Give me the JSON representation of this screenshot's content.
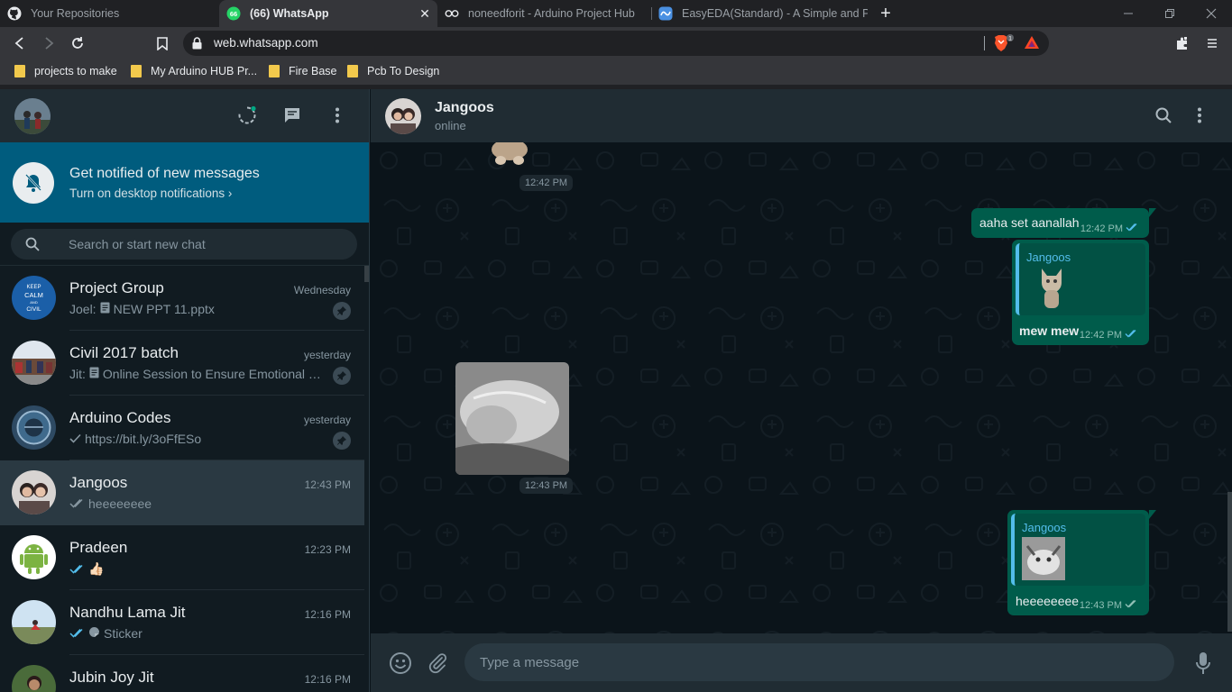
{
  "browser": {
    "tabs": [
      {
        "title": "Your Repositories",
        "icon": "github-icon",
        "active": false
      },
      {
        "title": "(66) WhatsApp",
        "icon": "whatsapp-icon",
        "active": true,
        "badge": "66"
      },
      {
        "title": "noneedforit - Arduino Project Hub",
        "icon": "arduino-icon",
        "active": false
      },
      {
        "title": "EasyEDA(Standard) - A Simple and Pow",
        "icon": "easyeda-icon",
        "active": false
      }
    ],
    "url": "web.whatsapp.com",
    "brave_badge": "1",
    "bookmarks": [
      "projects to make",
      "My Arduino HUB Pr...",
      "Fire Base",
      "Pcb To Design"
    ]
  },
  "sidebar": {
    "notification": {
      "title": "Get notified of new messages",
      "subtitle": "Turn on desktop notifications ›"
    },
    "search_placeholder": "Search or start new chat",
    "chats": [
      {
        "name": "Project Group",
        "time": "Wednesday",
        "prefix": "Joel:",
        "message": "NEW PPT 11.pptx",
        "icon": "document-icon",
        "pinned": false,
        "avatar_color": "#1b5fa8"
      },
      {
        "name": "Civil 2017 batch",
        "time": "yesterday",
        "prefix": "Jit:",
        "message": "Online Session to Ensure Emotional W...",
        "icon": "document-icon",
        "pinned": false,
        "avatar_color": "#6b4a3a"
      },
      {
        "name": "Arduino Codes",
        "time": "yesterday",
        "prefix": "",
        "message": "https://bit.ly/3oFfESo",
        "icon": "single-tick-icon",
        "pinned": false,
        "avatar_color": "#2e4a63"
      },
      {
        "name": "Jangoos",
        "time": "12:43 PM",
        "prefix": "",
        "message": "heeeeeeee",
        "icon": "double-tick-grey-icon",
        "pinned": false,
        "avatar_color": "#5a4a48",
        "selected": true
      },
      {
        "name": "Pradeen",
        "time": "12:23 PM",
        "prefix": "",
        "message": "👍🏻",
        "icon": "double-tick-blue-icon",
        "pinned": false,
        "avatar_color": "#ffffff"
      },
      {
        "name": "Nandhu Lama Jit",
        "time": "12:16 PM",
        "prefix": "",
        "message": "Sticker",
        "icon": "double-tick-blue-icon",
        "pinned": false,
        "avatar_color": "#9ec5e8"
      },
      {
        "name": "Jubin Joy Jit",
        "time": "12:16 PM",
        "prefix": "",
        "message": "",
        "icon": "",
        "pinned": false,
        "avatar_color": "#4a6b3a"
      }
    ]
  },
  "conversation": {
    "name": "Jangoos",
    "status": "online",
    "messages": {
      "incoming_sticker_time": "12:42 PM",
      "out1_text": "aaha set aanallah",
      "out1_time": "12:42 PM",
      "out2_quote_name": "Jangoos",
      "out2_text": "mew mew",
      "out2_time": "12:42 PM",
      "incoming_image_time": "12:43 PM",
      "out3_quote_name": "Jangoos",
      "out3_text": "heeeeeeee",
      "out3_time": "12:43 PM"
    },
    "composer_placeholder": "Type a message"
  },
  "colors": {
    "accent": "#00a884",
    "outgoing_bubble": "#005c4b",
    "read_tick": "#53bdeb",
    "notification_banner": "#005c7e"
  }
}
